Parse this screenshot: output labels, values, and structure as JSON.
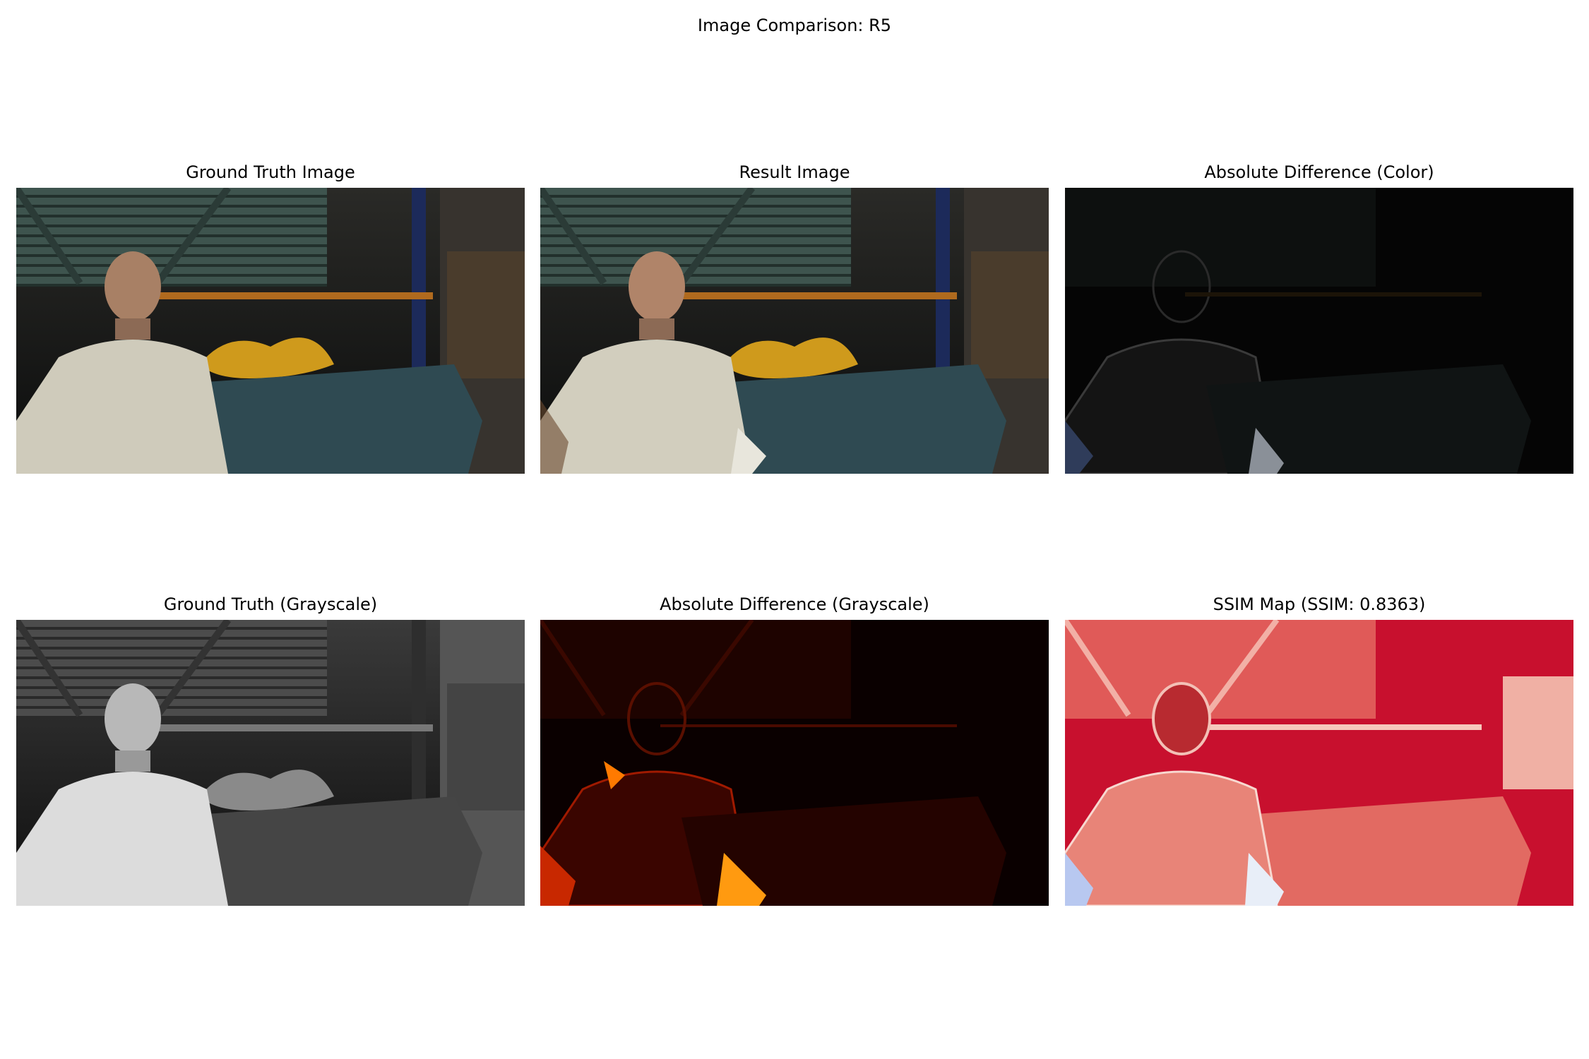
{
  "figure": {
    "title": "Image Comparison: R5"
  },
  "panels": [
    {
      "title": "Ground Truth Image",
      "kind": "color-render"
    },
    {
      "title": "Result Image",
      "kind": "color-render-artifacts"
    },
    {
      "title": "Absolute Difference (Color)",
      "kind": "diff-color"
    },
    {
      "title": "Ground Truth (Grayscale)",
      "kind": "grayscale-render"
    },
    {
      "title": "Absolute Difference (Grayscale)",
      "kind": "diff-heat"
    },
    {
      "title": "SSIM Map (SSIM: 0.8363)",
      "kind": "ssim-map"
    }
  ]
}
